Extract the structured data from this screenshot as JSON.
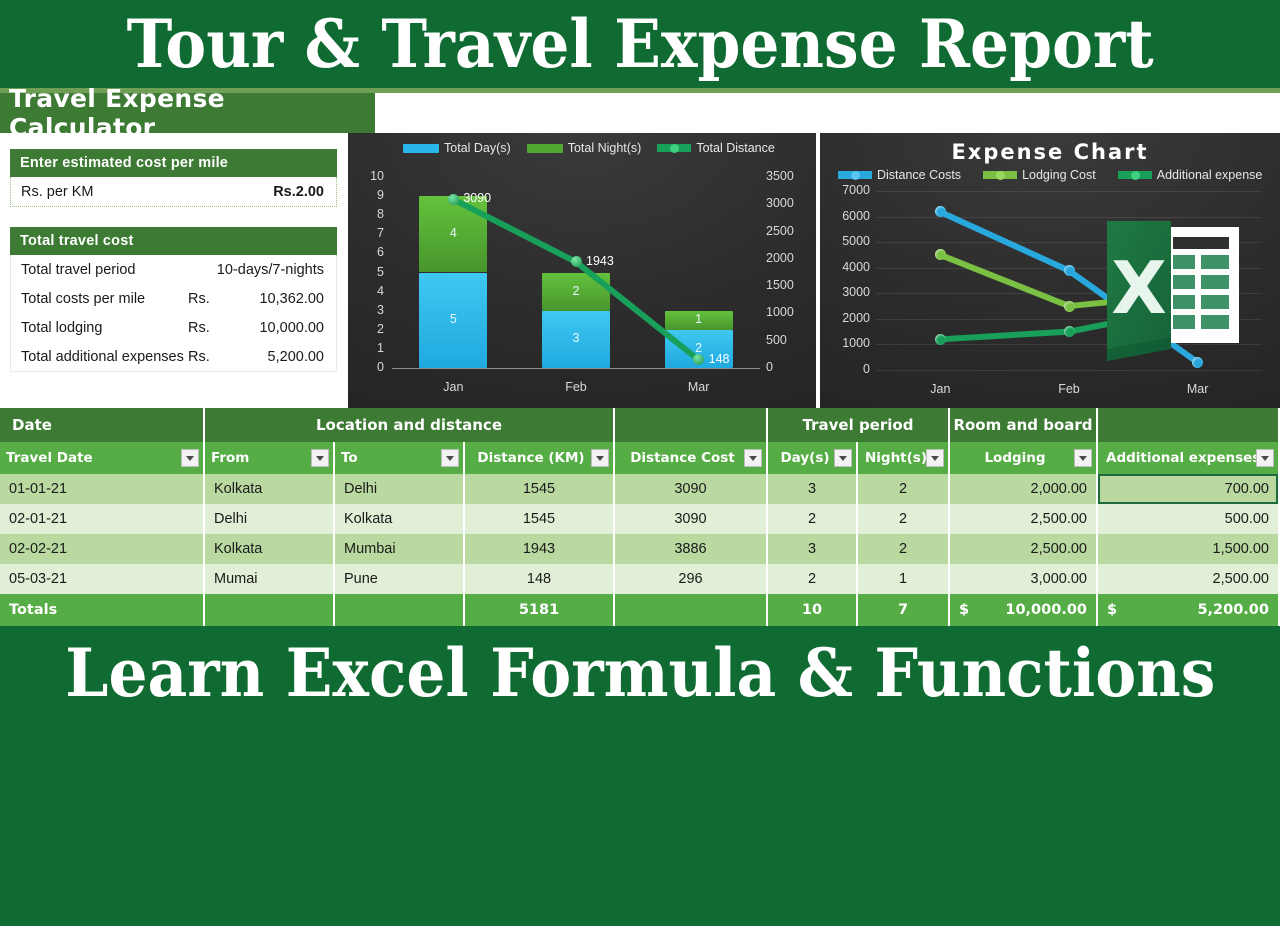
{
  "top_banner": {
    "text": "Tour & Travel Expense Report"
  },
  "bottom_banner": {
    "text": "Learn Excel Formula & Functions"
  },
  "calculator": {
    "title": "Travel Expense Calculator",
    "cost_group": {
      "heading": "Enter estimated cost per mile",
      "rows": [
        {
          "label": "Rs. per KM",
          "value": "Rs.2.00"
        }
      ]
    },
    "total_group": {
      "heading": "Total travel cost",
      "rows": [
        {
          "label": "Total travel period",
          "currency": "",
          "value": "10-days/7-nights"
        },
        {
          "label": "Total costs per mile",
          "currency": "Rs.",
          "value": "10,362.00"
        },
        {
          "label": "Total lodging",
          "currency": "Rs.",
          "value": "10,000.00"
        },
        {
          "label": "Total additional expenses",
          "currency": "Rs.",
          "value": "5,200.00"
        }
      ]
    }
  },
  "colors": {
    "brand_dark_green": "#0f6b32",
    "header_green": "#3d7a33",
    "table_green": "#56ad46",
    "row_odd": "#b9d9a0",
    "row_even": "#e0efd5",
    "series_blue": "#29b6e8",
    "series_green": "#52a832",
    "series_teal": "#18a05a"
  },
  "chart_data": [
    {
      "type": "bar",
      "title": "",
      "categories": [
        "Jan",
        "Feb",
        "Mar"
      ],
      "series": [
        {
          "name": "Total Day(s)",
          "type": "bar-stacked",
          "color": "#29b6e8",
          "values": [
            5,
            3,
            2
          ],
          "axis": "left"
        },
        {
          "name": "Total Night(s)",
          "type": "bar-stacked",
          "color": "#52a832",
          "values": [
            4,
            2,
            1
          ],
          "axis": "left"
        },
        {
          "name": "Total Distance",
          "type": "line",
          "color": "#18a05a",
          "values": [
            3090,
            1943,
            148
          ],
          "axis": "right"
        }
      ],
      "ylabel": "",
      "xlabel": "",
      "ylim": [
        0,
        10
      ],
      "y2lim": [
        0,
        3500
      ],
      "yticks": [
        "10",
        "9",
        "8",
        "7",
        "6",
        "5",
        "4",
        "3",
        "2",
        "1",
        "0"
      ],
      "y2ticks": [
        "3500",
        "3000",
        "2500",
        "2000",
        "1500",
        "1000",
        "500",
        "0"
      ],
      "legend_position": "top",
      "grid": false
    },
    {
      "type": "line",
      "title": "Expense Chart",
      "categories": [
        "Jan",
        "Feb",
        "Mar"
      ],
      "series": [
        {
          "name": "Distance Costs",
          "color": "#29a8dd",
          "values": [
            6180,
            3886,
            296
          ]
        },
        {
          "name": "Lodging Cost",
          "color": "#7ac143",
          "values": [
            4500,
            2500,
            3000
          ]
        },
        {
          "name": "Additional expense",
          "color": "#18a05a",
          "values": [
            1200,
            1500,
            2500
          ]
        }
      ],
      "ylabel": "",
      "xlabel": "",
      "ylim": [
        0,
        7000
      ],
      "yticks": [
        "7000",
        "6000",
        "5000",
        "4000",
        "3000",
        "2000",
        "1000",
        "0"
      ],
      "legend_position": "top",
      "grid": true
    }
  ],
  "table": {
    "group_headers": [
      {
        "label": "Date",
        "align": "left"
      },
      {
        "label": "Location and distance",
        "align": "center"
      },
      {
        "label": "",
        "align": "center"
      },
      {
        "label": "Travel period",
        "align": "center"
      },
      {
        "label": "Room and board",
        "align": "center"
      },
      {
        "label": "",
        "align": "center"
      }
    ],
    "columns": [
      "Travel Date",
      "From",
      "To",
      "Distance (KM)",
      "Distance Cost",
      "Day(s)",
      "Night(s)",
      "Lodging",
      "Additional expenses"
    ],
    "rows": [
      {
        "travel_date": "01-01-21",
        "from": "Kolkata",
        "to": "Delhi",
        "distance_km": "1545",
        "distance_cost": "3090",
        "days": "3",
        "nights": "2",
        "lodging": "2,000.00",
        "additional": "700.00"
      },
      {
        "travel_date": "02-01-21",
        "from": "Delhi",
        "to": "Kolkata",
        "distance_km": "1545",
        "distance_cost": "3090",
        "days": "2",
        "nights": "2",
        "lodging": "2,500.00",
        "additional": "500.00"
      },
      {
        "travel_date": "02-02-21",
        "from": "Kolkata",
        "to": "Mumbai",
        "distance_km": "1943",
        "distance_cost": "3886",
        "days": "3",
        "nights": "2",
        "lodging": "2,500.00",
        "additional": "1,500.00"
      },
      {
        "travel_date": "05-03-21",
        "from": "Mumai",
        "to": "Pune",
        "distance_km": "148",
        "distance_cost": "296",
        "days": "2",
        "nights": "1",
        "lodging": "3,000.00",
        "additional": "2,500.00"
      }
    ],
    "totals": {
      "label": "Totals",
      "from": "",
      "to": "",
      "distance_km": "5181",
      "distance_cost": "",
      "days": "10",
      "nights": "7",
      "lodging_symbol": "$",
      "lodging": "10,000.00",
      "additional_symbol": "$",
      "additional": "5,200.00"
    },
    "selected_cell": "additional expenses row 1"
  }
}
